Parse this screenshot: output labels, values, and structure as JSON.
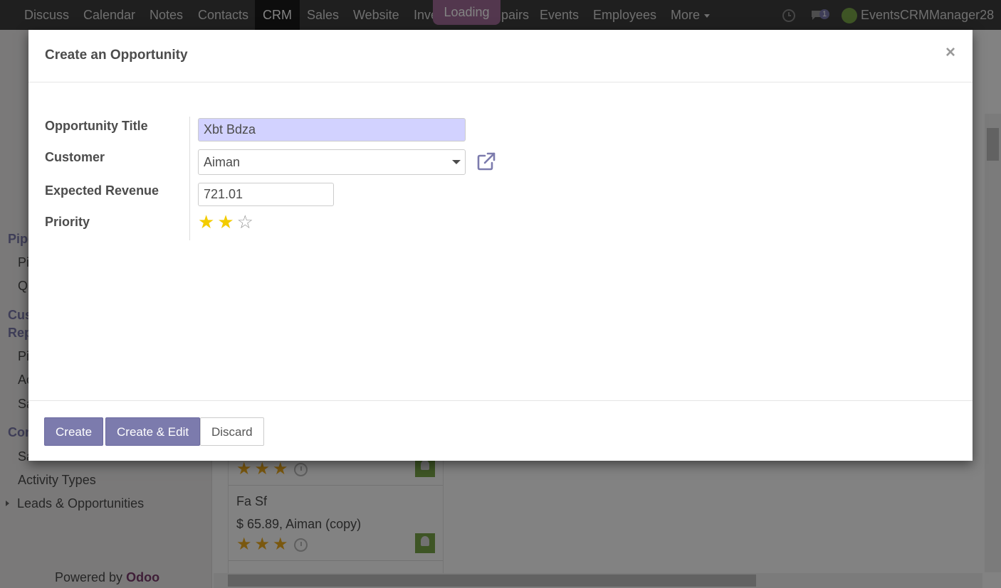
{
  "navbar": {
    "items": [
      "Discuss",
      "Calendar",
      "Notes",
      "Contacts",
      "CRM",
      "Sales",
      "Website",
      "Inve",
      "pairs",
      "Events",
      "Employees"
    ],
    "more_label": "More",
    "loading_label": "Loading",
    "chat_count": "1",
    "user_name": "EventsCRMManager28"
  },
  "sidebar": {
    "sections": [
      {
        "head": "Pipe",
        "items": [
          "Pi",
          "Qu"
        ]
      },
      {
        "head": "Cus",
        "head2": "Rep",
        "items": [
          "Pi",
          "Ac",
          "Sa"
        ]
      },
      {
        "head": "Con",
        "items": [
          "Sa",
          "Activity Types"
        ]
      }
    ],
    "expandable_item": "Leads & Opportunities",
    "powered_by": "Powered by",
    "powered_brand": "Odoo"
  },
  "kanban": {
    "cards": [
      {
        "title": "",
        "subtitle": "",
        "stars": 3
      },
      {
        "title": "Fa Sf",
        "subtitle": "$ 65.89, Aiman (copy)",
        "stars": 3
      }
    ]
  },
  "modal": {
    "title": "Create an Opportunity",
    "close_symbol": "×",
    "fields": {
      "title_label": "Opportunity Title",
      "title_value": "Xbt Bdza",
      "customer_label": "Customer",
      "customer_value": "Aiman",
      "revenue_label": "Expected Revenue",
      "revenue_value": "721.01",
      "priority_label": "Priority",
      "priority_value": 2,
      "priority_max": 3
    },
    "buttons": {
      "create": "Create",
      "create_edit": "Create & Edit",
      "discard": "Discard"
    }
  },
  "colors": {
    "accent": "#7c7bad",
    "brand": "#7c3c6e",
    "required_bg": "#d2d2ff",
    "star": "#f3cc00"
  }
}
